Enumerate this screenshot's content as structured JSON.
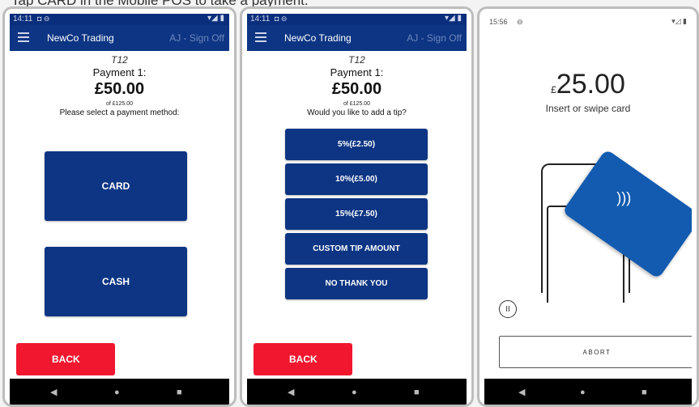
{
  "caption": "Tap CARD in the Mobile POS to take a payment.",
  "screen1": {
    "status_time": "14:11",
    "status_icons": "◘ ⊖",
    "status_right": "▾◢ ▮",
    "app_title": "NewCo Trading",
    "signoff": "AJ - Sign Off",
    "table": "T12",
    "payment_label": "Payment 1:",
    "amount": "£50.00",
    "of_total": "of £125.00",
    "prompt": "Please select a payment method:",
    "card_label": "CARD",
    "cash_label": "CASH",
    "back_label": "BACK"
  },
  "screen2": {
    "status_time": "14:11",
    "status_icons": "◘ ⊖",
    "status_right": "▾◢ ▮",
    "app_title": "NewCo Trading",
    "signoff": "AJ - Sign Off",
    "table": "T12",
    "payment_label": "Payment 1:",
    "amount": "£50.00",
    "of_total": "of £125.00",
    "prompt": "Would you like to add a tip?",
    "tip_options": [
      "5%(£2.50)",
      "10%(£5.00)",
      "15%(£7.50)",
      "CUSTOM TIP AMOUNT",
      "NO THANK YOU"
    ],
    "back_label": "BACK"
  },
  "screen3": {
    "status_time": "15:56",
    "status_sim": "⊖",
    "status_right": "▾◿ ▮",
    "currency": "£",
    "amount": "25.00",
    "prompt": "Insert or swipe card",
    "pause_glyph": "II",
    "abort_label": "ABORT"
  },
  "nav": {
    "back": "◀",
    "home": "●",
    "recent": "■"
  },
  "colors": {
    "appbar": "#0d3583",
    "button": "#0d3583",
    "back": "#f0172f",
    "card": "#125bb0"
  }
}
